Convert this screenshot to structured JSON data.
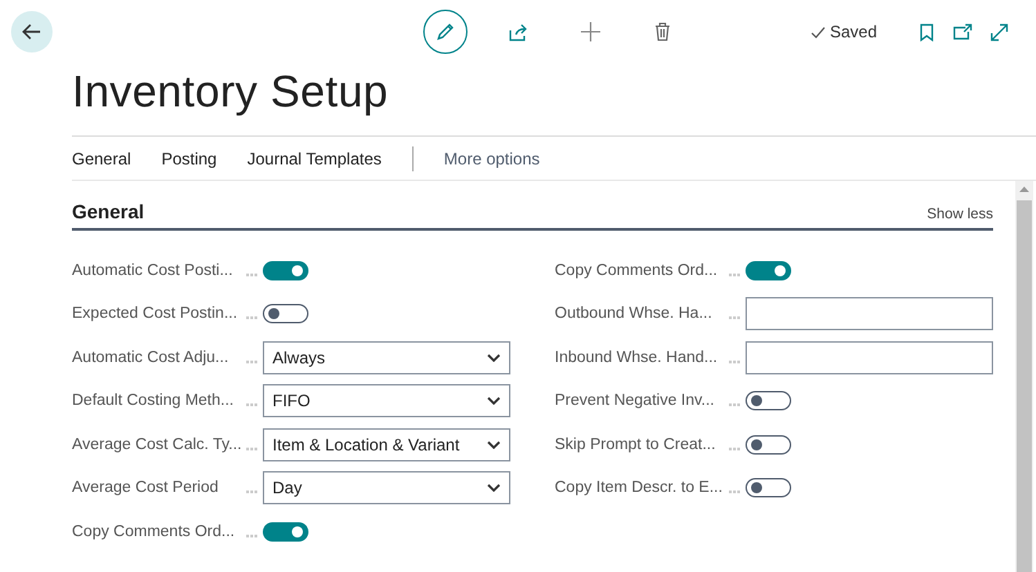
{
  "toolbar": {
    "status": "Saved"
  },
  "page": {
    "title": "Inventory Setup"
  },
  "tabs": [
    {
      "label": "General"
    },
    {
      "label": "Posting"
    },
    {
      "label": "Journal Templates"
    },
    {
      "label": "More options",
      "kind": "more"
    }
  ],
  "section": {
    "title": "General",
    "toggle_label": "Show less"
  },
  "columns": [
    [
      {
        "label": "Automatic Cost Posti...",
        "kind": "toggle",
        "on": true
      },
      {
        "label": "Expected Cost Postin...",
        "kind": "toggle",
        "on": false
      },
      {
        "label": "Automatic Cost Adju...",
        "kind": "select",
        "value": "Always"
      },
      {
        "label": "Default Costing Meth...",
        "kind": "select",
        "value": "FIFO"
      },
      {
        "label": "Average Cost Calc. Ty...",
        "kind": "select",
        "value": "Item & Location & Variant"
      },
      {
        "label": "Average Cost Period",
        "kind": "select",
        "value": "Day"
      },
      {
        "label": "Copy Comments Ord...",
        "kind": "toggle",
        "on": true
      }
    ],
    [
      {
        "label": "Copy Comments Ord...",
        "kind": "toggle",
        "on": true
      },
      {
        "label": "Outbound Whse. Ha...",
        "kind": "text"
      },
      {
        "label": "Inbound Whse. Hand...",
        "kind": "text"
      },
      {
        "label": "Prevent Negative Inv...",
        "kind": "toggle",
        "on": false
      },
      {
        "label": "Skip Prompt to Creat...",
        "kind": "toggle",
        "on": false
      },
      {
        "label": "Copy Item Descr. to E...",
        "kind": "toggle",
        "on": false
      }
    ]
  ]
}
